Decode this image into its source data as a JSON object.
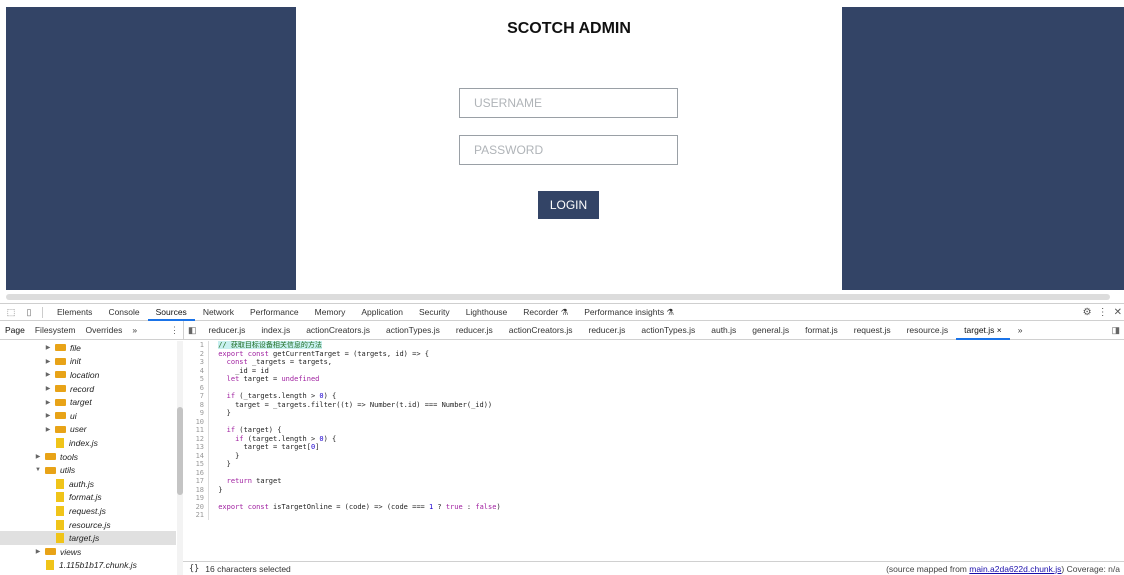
{
  "app": {
    "title": "SCOTCH ADMIN",
    "username_placeholder": "USERNAME",
    "password_placeholder": "PASSWORD",
    "login_label": "LOGIN",
    "brand_color": "#334466"
  },
  "devtools": {
    "tabs": [
      "Elements",
      "Console",
      "Sources",
      "Network",
      "Performance",
      "Memory",
      "Application",
      "Security",
      "Lighthouse",
      "Recorder ⚗",
      "Performance insights ⚗"
    ],
    "active_tab": "Sources",
    "nav_tabs": [
      "Page",
      "Filesystem",
      "Overrides",
      "»"
    ],
    "file_tabs": [
      "reducer.js",
      "index.js",
      "actionCreators.js",
      "actionTypes.js",
      "reducer.js",
      "actionCreators.js",
      "reducer.js",
      "actionTypes.js",
      "auth.js",
      "general.js",
      "format.js",
      "request.js",
      "resource.js",
      "target.js ×",
      "»"
    ],
    "active_file": "target.js ×",
    "tree": [
      {
        "label": "file",
        "type": "folder",
        "depth": 1
      },
      {
        "label": "init",
        "type": "folder",
        "depth": 1
      },
      {
        "label": "location",
        "type": "folder",
        "depth": 1
      },
      {
        "label": "record",
        "type": "folder",
        "depth": 1
      },
      {
        "label": "target",
        "type": "folder",
        "depth": 1
      },
      {
        "label": "ui",
        "type": "folder",
        "depth": 1
      },
      {
        "label": "user",
        "type": "folder",
        "depth": 1
      },
      {
        "label": "index.js",
        "type": "file",
        "depth": 1
      },
      {
        "label": "tools",
        "type": "folder",
        "depth": 0
      },
      {
        "label": "utils",
        "type": "folder-open",
        "depth": 0
      },
      {
        "label": "auth.js",
        "type": "file",
        "depth": 1
      },
      {
        "label": "format.js",
        "type": "file",
        "depth": 1
      },
      {
        "label": "request.js",
        "type": "file",
        "depth": 1
      },
      {
        "label": "resource.js",
        "type": "file",
        "depth": 1
      },
      {
        "label": "target.js",
        "type": "file",
        "depth": 1,
        "selected": true
      },
      {
        "label": "views",
        "type": "folder",
        "depth": 0
      },
      {
        "label": "1.115b1b17.chunk.js",
        "type": "file",
        "depth": 0
      }
    ],
    "code": [
      "// 获取目标设备相关信息的方法",
      "export const getCurrentTarget = (targets, id) => {",
      "  const _targets = targets,",
      "    _id = id",
      "  let target = undefined",
      "",
      "  if (_targets.length > 0) {",
      "    target = _targets.filter((t) => Number(t.id) === Number(_id))",
      "  }",
      "",
      "  if (target) {",
      "    if (target.length > 0) {",
      "      target = target[0]",
      "    }",
      "  }",
      "",
      "  return target",
      "}",
      "",
      "export const isTargetOnline = (code) => (code === 1 ? true : false)",
      ""
    ],
    "status_braces": "{}",
    "status_selection": "16 characters selected",
    "status_mapped_prefix": "(source mapped from ",
    "status_mapped_link": "main.a2da622d.chunk.js",
    "status_mapped_suffix": ") Coverage: n/a"
  }
}
